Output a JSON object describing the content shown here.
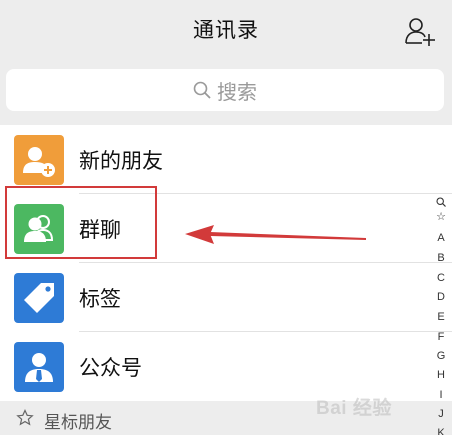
{
  "header": {
    "title": "通讯录",
    "add_contact_icon": "add-contact-icon"
  },
  "search": {
    "placeholder": "搜索",
    "icon": "search-icon"
  },
  "list": {
    "items": [
      {
        "label": "新的朋友",
        "icon": "new-friends-icon",
        "color": "#f09d3a"
      },
      {
        "label": "群聊",
        "icon": "group-chat-icon",
        "color": "#4cb861"
      },
      {
        "label": "标签",
        "icon": "tag-icon",
        "color": "#2e7bd6"
      },
      {
        "label": "公众号",
        "icon": "official-account-icon",
        "color": "#2e7bd6"
      }
    ]
  },
  "section": {
    "label": "星标朋友",
    "icon": "star-icon"
  },
  "index": {
    "search_symbol": "🔍",
    "star_symbol": "☆",
    "letters": [
      "A",
      "B",
      "C",
      "D",
      "E",
      "F",
      "G",
      "H",
      "I",
      "J",
      "K"
    ]
  },
  "annotation": {
    "highlight_color": "#d23a3a"
  },
  "watermark": {
    "text": "Bai 经验"
  }
}
